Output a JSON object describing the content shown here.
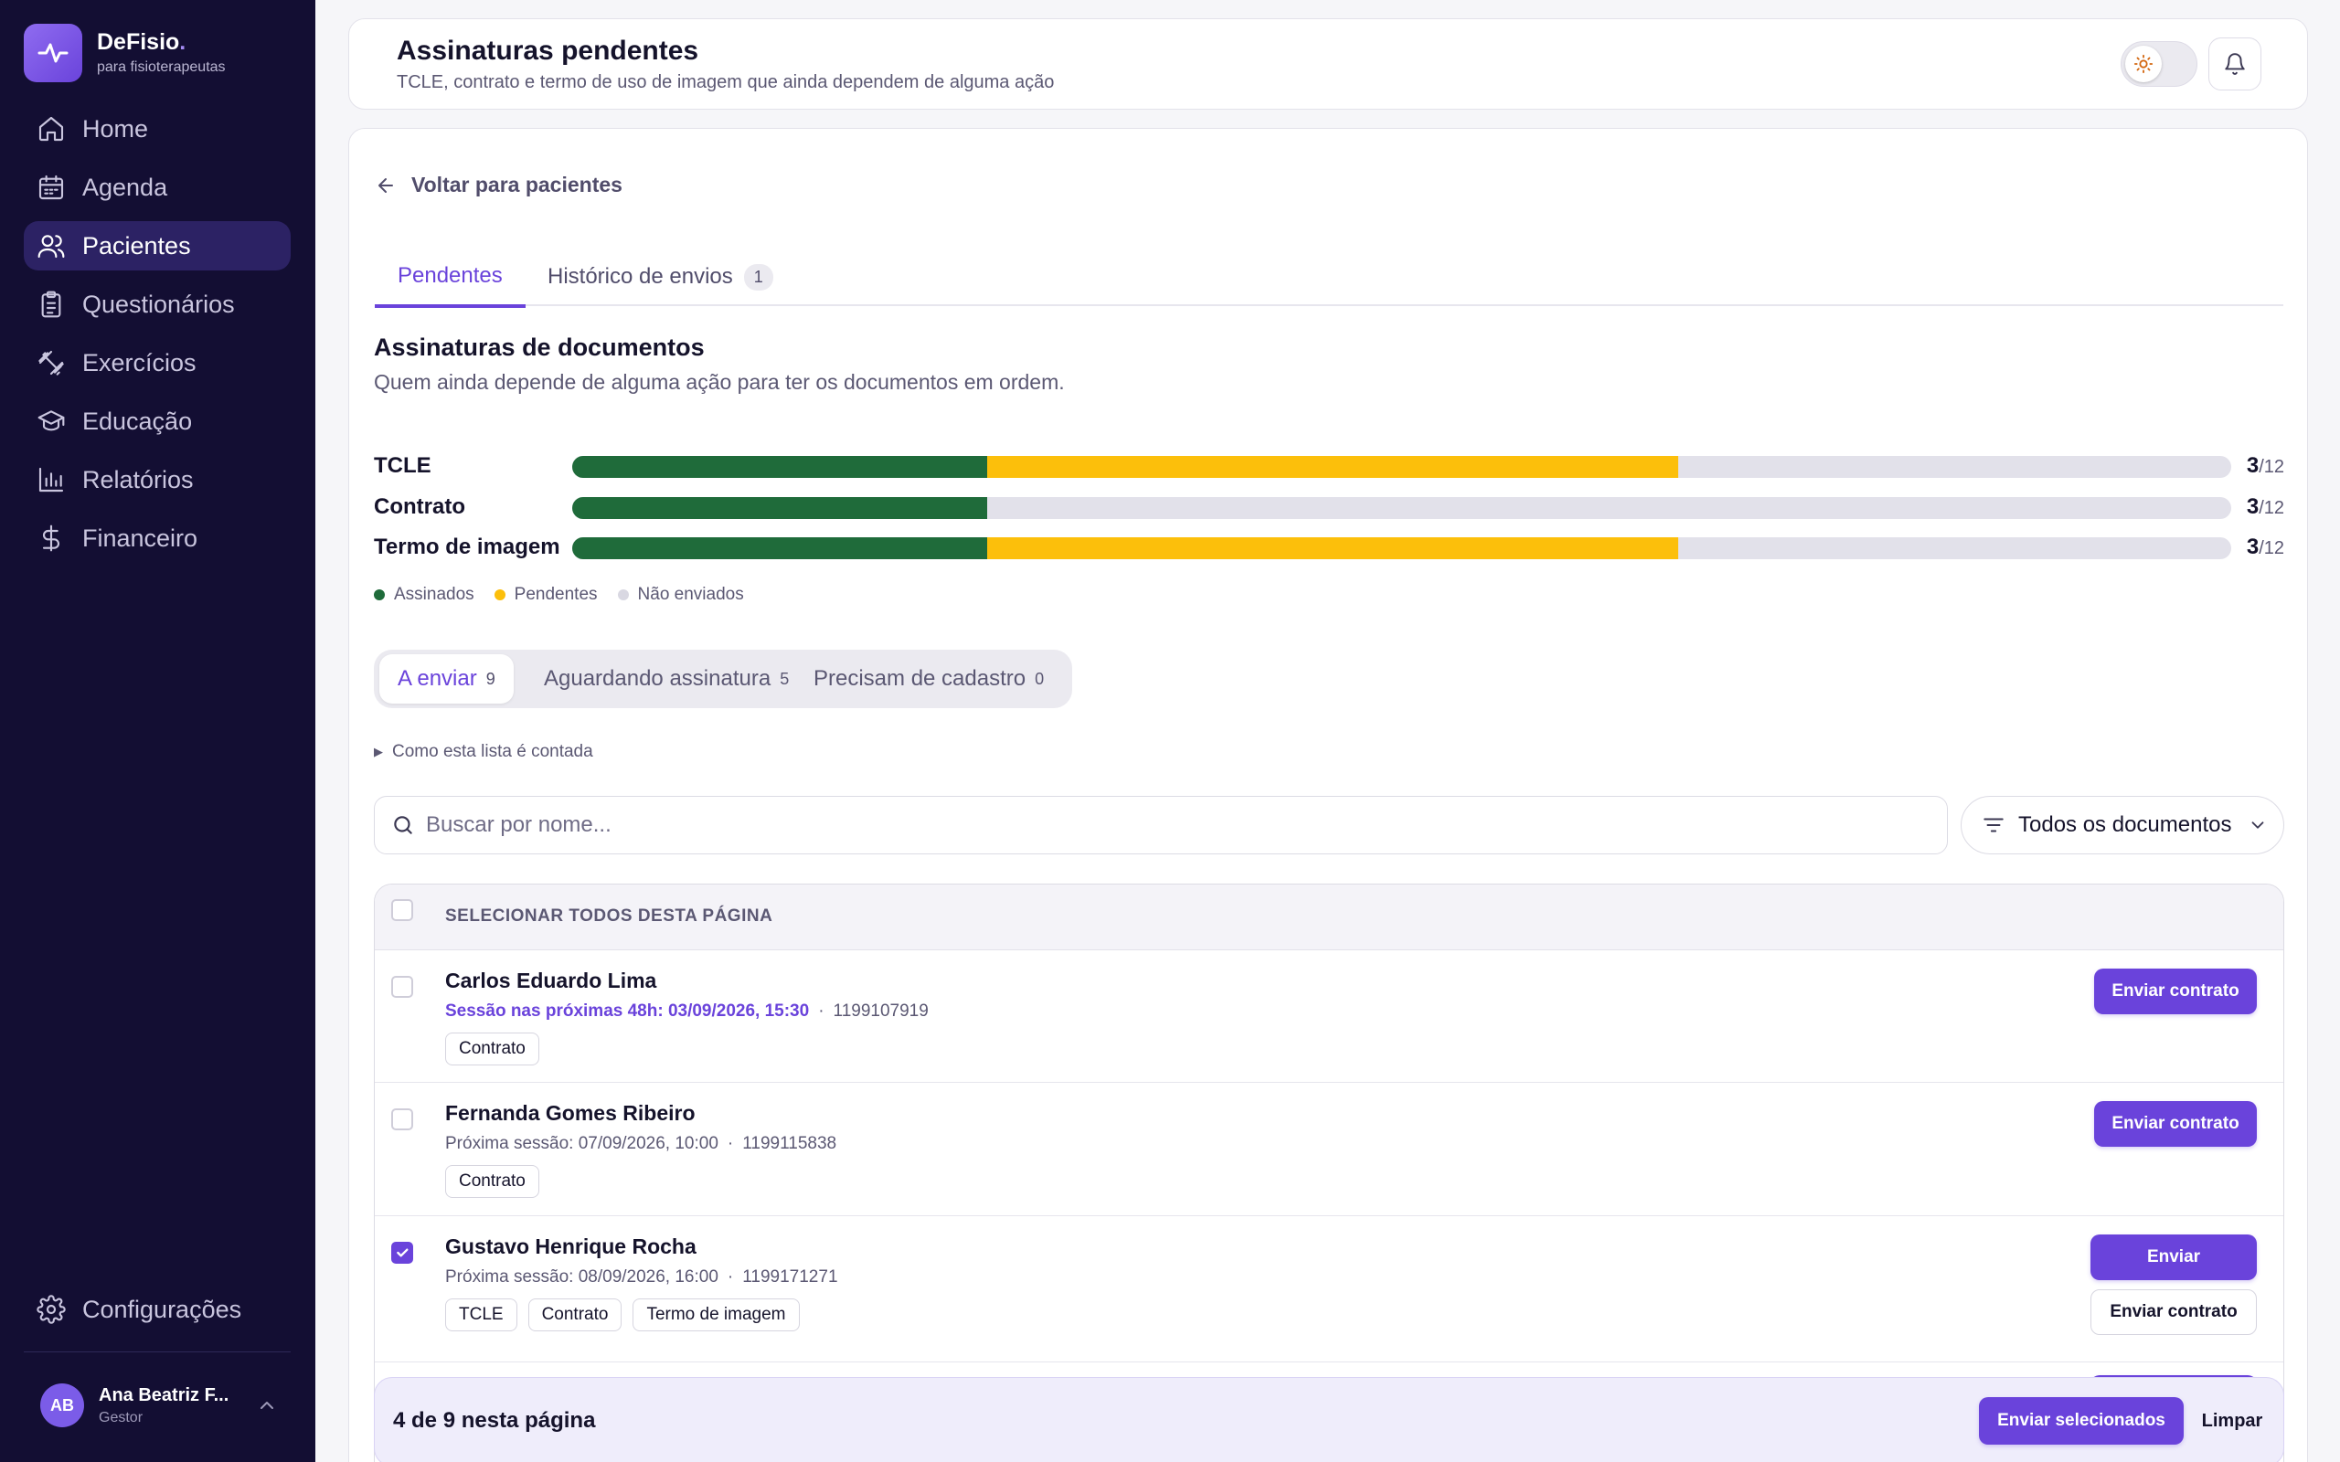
{
  "brand": {
    "name": "DeFisio",
    "dot": ".",
    "subtitle": "para fisioterapeutas",
    "logo_icon": "pulse-icon"
  },
  "nav": {
    "items": [
      {
        "label": "Home",
        "icon": "home-icon"
      },
      {
        "label": "Agenda",
        "icon": "calendar-icon"
      },
      {
        "label": "Pacientes",
        "icon": "users-icon",
        "active": true
      },
      {
        "label": "Questionários",
        "icon": "clipboard-icon"
      },
      {
        "label": "Exercícios",
        "icon": "dumbbell-icon"
      },
      {
        "label": "Educação",
        "icon": "graduation-cap-icon"
      },
      {
        "label": "Relatórios",
        "icon": "bar-chart-icon"
      },
      {
        "label": "Financeiro",
        "icon": "dollar-icon"
      }
    ],
    "settings_label": "Configurações"
  },
  "user": {
    "initials": "AB",
    "name": "Ana Beatriz F...",
    "role": "Gestor"
  },
  "header": {
    "title": "Assinaturas pendentes",
    "subtitle": "TCLE, contrato e termo de uso de imagem que ainda dependem de alguma ação"
  },
  "back_label": "Voltar para pacientes",
  "tabs": [
    {
      "label": "Pendentes",
      "active": true
    },
    {
      "label": "Histórico de envios",
      "badge": "1"
    }
  ],
  "section": {
    "title": "Assinaturas de documentos",
    "subtitle": "Quem ainda depende de alguma ação para ter os documentos em ordem."
  },
  "progress": {
    "total_label": "/12",
    "rows": [
      {
        "label": "TCLE",
        "signed": 3,
        "pending": 5,
        "total": 12,
        "count": "3"
      },
      {
        "label": "Contrato",
        "signed": 3,
        "pending": 0,
        "total": 12,
        "count": "3"
      },
      {
        "label": "Termo de imagem",
        "signed": 3,
        "pending": 5,
        "total": 12,
        "count": "3"
      }
    ]
  },
  "legend": [
    {
      "label": "Assinados",
      "color": "#1f6b3a"
    },
    {
      "label": "Pendentes",
      "color": "#fcbf0b"
    },
    {
      "label": "Não enviados",
      "color": "#d9d8e2"
    }
  ],
  "segments": [
    {
      "label": "A enviar",
      "count": "9",
      "active": true
    },
    {
      "label": "Aguardando assinatura",
      "count": "5"
    },
    {
      "label": "Precisam de cadastro",
      "count": "0"
    }
  ],
  "disclosure_label": "Como esta lista é contada",
  "search": {
    "placeholder": "Buscar por nome..."
  },
  "filter": {
    "label": "Todos os documentos"
  },
  "list": {
    "select_all_label": "SELECIONAR TODOS DESTA PÁGINA",
    "rows": [
      {
        "name": "Carlos Eduardo Lima",
        "session": "Sessão nas próximas 48h: 03/09/2026, 15:30",
        "urgent": true,
        "phone": "1199107919",
        "docs": [
          "Contrato"
        ],
        "checked": false,
        "primary_label": "Enviar contrato"
      },
      {
        "name": "Fernanda Gomes Ribeiro",
        "session": "Próxima sessão: 07/09/2026, 10:00",
        "urgent": false,
        "phone": "1199115838",
        "docs": [
          "Contrato"
        ],
        "checked": false,
        "primary_label": "Enviar contrato"
      },
      {
        "name": "Gustavo Henrique Rocha",
        "session": "Próxima sessão: 08/09/2026, 16:00",
        "urgent": false,
        "phone": "1199171271",
        "docs": [
          "TCLE",
          "Contrato",
          "Termo de imagem"
        ],
        "checked": true,
        "primary_label": "Enviar",
        "secondary_label": "Enviar contrato"
      }
    ]
  },
  "bulk": {
    "count_label": "4 de 9 nesta página",
    "send_label": "Enviar selecionados",
    "clear_label": "Limpar"
  },
  "colors": {
    "accent": "#6a43db",
    "sidebar": "#130e33",
    "signed": "#1f6b3a",
    "pending": "#fcbf0b"
  }
}
